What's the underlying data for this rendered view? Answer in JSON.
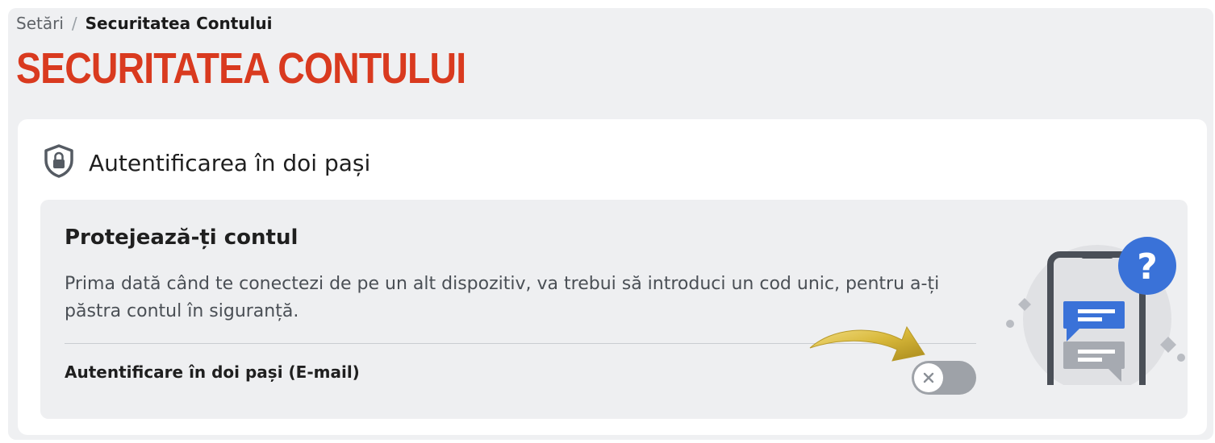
{
  "breadcrumb": {
    "parent": "Setări",
    "separator": "/",
    "current": "Securitatea Contului"
  },
  "page": {
    "title": "SECURITATEA CONTULUI"
  },
  "card": {
    "icon": "shield-lock-icon",
    "title": "Autentificarea în doi pași"
  },
  "panel": {
    "title": "Protejează-ți contul",
    "description": "Prima dată când te conectezi de pe un alt dispozitiv, va trebui să introduci un cod unic, pentru a-ți păstra contul în siguranță.",
    "toggle": {
      "label": "Autentificare în doi pași (E-mail)",
      "state": "off",
      "knob_icon": "close-icon"
    },
    "illustration": {
      "icon": "phone-chat-question-icon",
      "question_mark": "?"
    }
  },
  "colors": {
    "title_red": "#d93a1f",
    "accent_blue": "#3a72d8",
    "toggle_off": "#9ea2a8",
    "arrow_gold": "#d8b83a"
  }
}
